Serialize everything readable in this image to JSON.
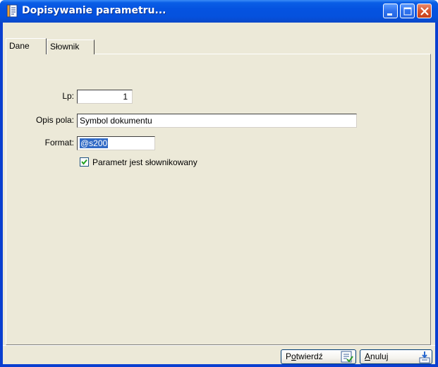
{
  "window": {
    "title": "Dopisywanie parametru...",
    "icon": "document-edit-icon",
    "controls": [
      "minimize-icon",
      "maximize-icon",
      "close-icon"
    ]
  },
  "tabs": [
    {
      "label": "Dane",
      "active": true
    },
    {
      "label": "Słownik",
      "active": false
    }
  ],
  "form": {
    "lp": {
      "label": "Lp:",
      "value": "1"
    },
    "opis": {
      "label": "Opis pola:",
      "value": "Symbol dokumentu"
    },
    "format": {
      "label": "Format:",
      "value": "@s200",
      "selected": true
    },
    "slownikowany": {
      "label": "Parametr jest słownikowany",
      "checked": true
    }
  },
  "buttons": {
    "confirm": {
      "pre": "P",
      "u": "o",
      "post": "twierdź",
      "icon": "confirm-document-icon"
    },
    "cancel": {
      "pre": "",
      "u": "A",
      "post": "nuluj",
      "icon": "cancel-arrow-icon"
    }
  },
  "colors": {
    "titlebar": "#0553e0",
    "dialog_bg": "#ece9d8",
    "selection": "#316ac5",
    "check": "#21a121"
  }
}
